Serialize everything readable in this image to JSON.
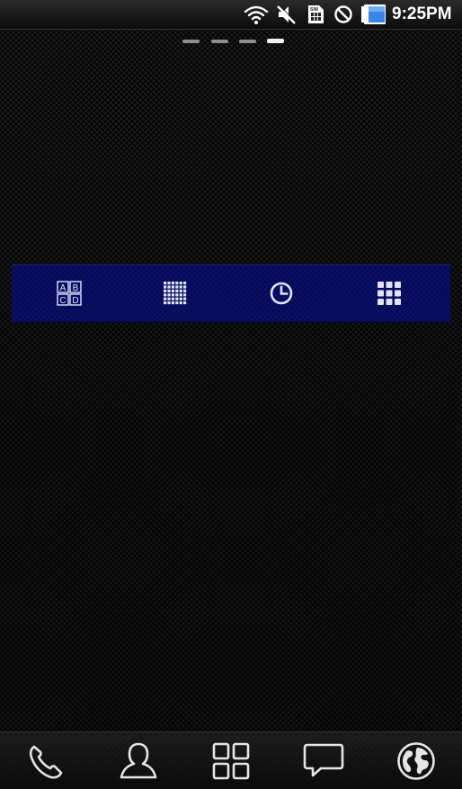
{
  "status_bar": {
    "time": "9:25PM",
    "icons": [
      "wifi-icon",
      "mute-icon",
      "sim-card-icon",
      "no-signal-icon",
      "battery-icon"
    ],
    "battery_color": "#3a86e0"
  },
  "home": {
    "page_count": 4,
    "active_page": 4
  },
  "widget": {
    "background": "#0a1072",
    "buttons": [
      {
        "icon": "abcd-grid-icon",
        "letters": [
          "A",
          "B",
          "C",
          "D"
        ]
      },
      {
        "icon": "dot-grid-icon"
      },
      {
        "icon": "clock-icon"
      },
      {
        "icon": "apps-grid-icon"
      }
    ]
  },
  "dock": {
    "items": [
      {
        "icon": "phone-icon"
      },
      {
        "icon": "contacts-icon"
      },
      {
        "icon": "app-drawer-icon"
      },
      {
        "icon": "messaging-icon"
      },
      {
        "icon": "browser-globe-icon"
      }
    ]
  }
}
